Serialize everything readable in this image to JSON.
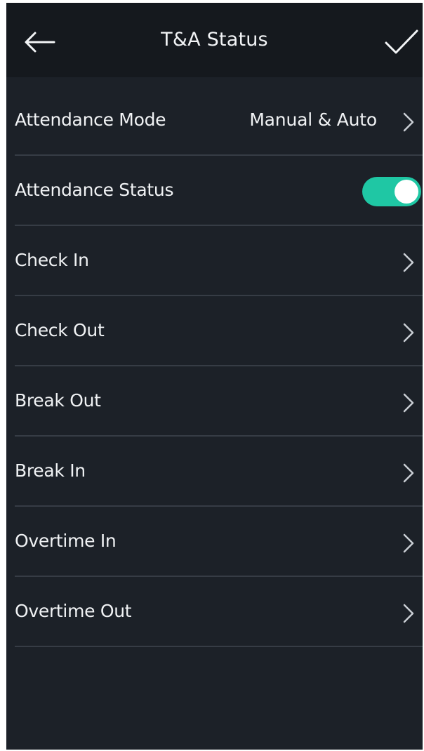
{
  "header": {
    "title": "T&A Status",
    "back_icon": "arrow-left-icon",
    "confirm_icon": "checkmark-icon"
  },
  "settings": {
    "attendance_mode": {
      "label": "Attendance Mode",
      "value": "Manual & Auto"
    },
    "attendance_status": {
      "label": "Attendance Status",
      "enabled": true
    },
    "statuses": [
      {
        "label": "Check In"
      },
      {
        "label": "Check Out"
      },
      {
        "label": "Break Out"
      },
      {
        "label": "Break In"
      },
      {
        "label": "Overtime In"
      },
      {
        "label": "Overtime Out"
      }
    ]
  },
  "colors": {
    "background": "#1c2128",
    "header_background": "#15191e",
    "divider": "#363c45",
    "toggle_on": "#1fc7a4",
    "text": "#f0f2f4"
  }
}
